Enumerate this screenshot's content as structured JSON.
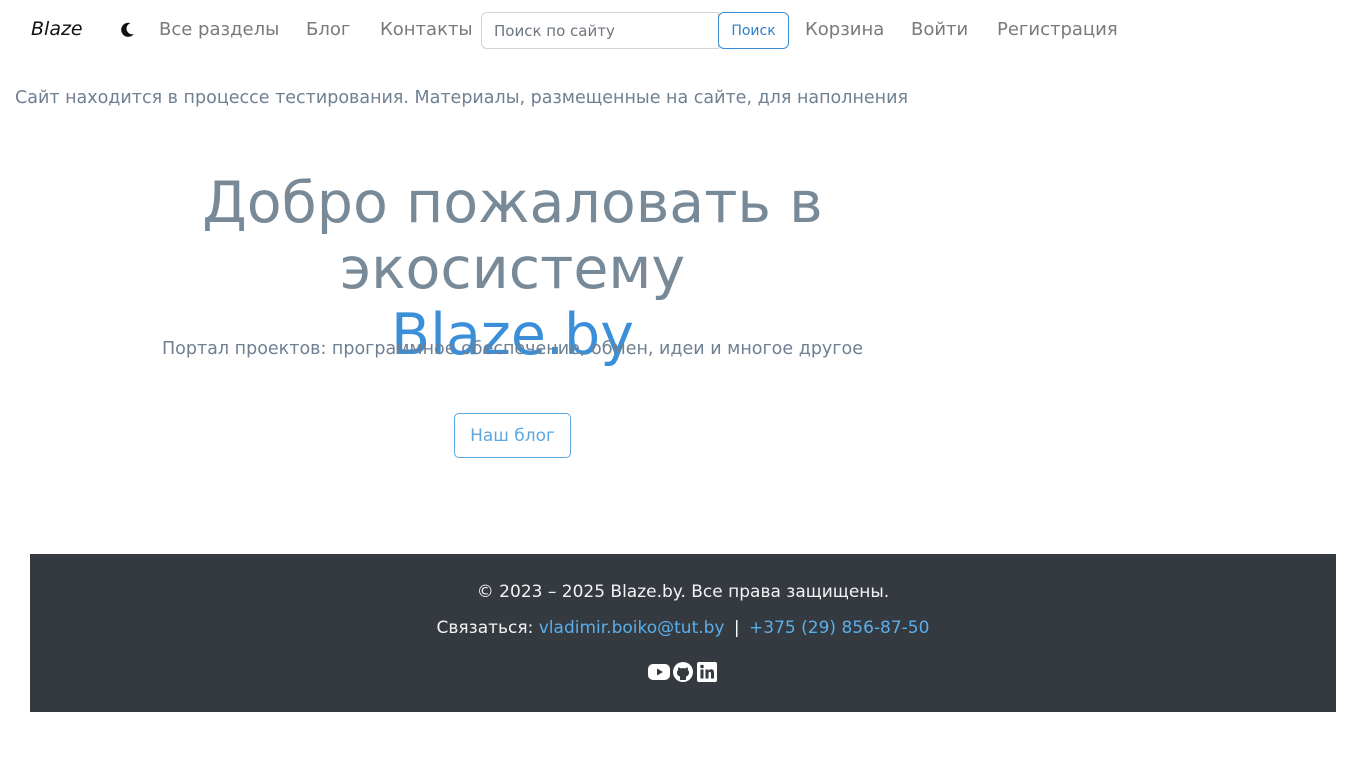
{
  "navbar": {
    "brand": "Blaze",
    "theme_icon": "moon-icon",
    "links": [
      "Все разделы",
      "Блог",
      "Контакты",
      "Корзина",
      "Войти",
      "Регистрация"
    ],
    "search": {
      "placeholder": "Поиск по сайту",
      "value": "",
      "button_label": "Поиск"
    }
  },
  "notice": "Сайт находится в процессе тестирования. Материалы, размещенные на сайте, для наполнения",
  "hero": {
    "title": "Добро пожаловать в экосистему",
    "brand": "Blaze.by",
    "subtitle": "Портал проектов: программное обеспечение, обмен, идеи и многое другое",
    "button_label": "Наш блог"
  },
  "footer": {
    "copyright": "© 2023 – 2025 Blaze.by. Все права защищены.",
    "contact_label": "Связаться:",
    "email": "vladimir.boiko@tut.by",
    "separator": "|",
    "phone": "+375 (29) 856-87-50",
    "social_icons": [
      "youtube-icon",
      "github-icon",
      "linkedin-icon"
    ]
  },
  "colors": {
    "accent": "#3a8fd8",
    "muted_text": "#708090",
    "footer_bg": "#343a40"
  }
}
